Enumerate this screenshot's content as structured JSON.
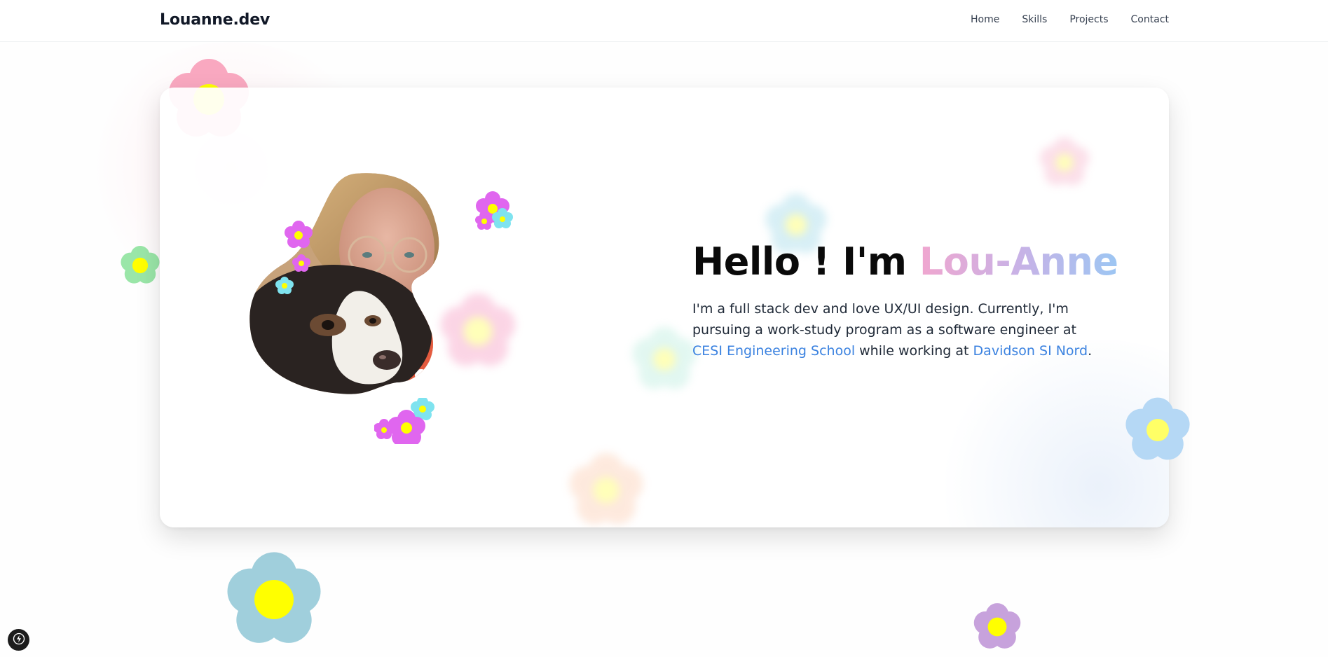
{
  "nav": {
    "brand": "Louanne.dev",
    "links": [
      "Home",
      "Skills",
      "Projects",
      "Contact"
    ]
  },
  "hero": {
    "greeting": "Hello ! I'm",
    "name": "Lou-Anne",
    "description_part1": "I'm a full stack dev and love UX/UI design. Currently, I'm pursuing a work-study program as a software engineer at",
    "school_link": "CESI Engineering School",
    "description_part2": " while working at ",
    "company_link": "Davidson SI Nord",
    "description_end": "."
  },
  "colors": {
    "name_gradient": [
      "#f0a6cf",
      "#c8b2e6",
      "#9cc6f3"
    ],
    "link": "#3b82e0",
    "flower_center": "#ffff00",
    "flower_pink": "#f9a8c0",
    "flower_green": "#9ae6a8",
    "flower_blue": "#a0cfdc",
    "flower_purple": "#c7a2dc",
    "flower_magenta": "#e066ef",
    "flower_cyan": "#7fe3ef",
    "flower_peach": "#fcd0b6",
    "flower_skyblue": "#b5d8f5"
  },
  "icons": {
    "portrait": "portrait-with-dog-image",
    "flower": "flower-icon",
    "devtools": "lightning-icon"
  }
}
